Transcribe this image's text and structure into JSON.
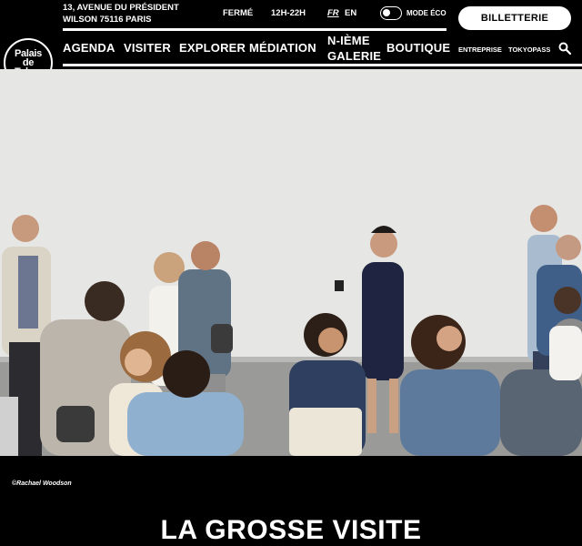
{
  "header": {
    "logo_text": "Palais\nde\nTokyo",
    "address": "13, AVENUE DU PRÉSIDENT\nWILSON 75116 PARIS",
    "status": "FERMÉ",
    "hours": "12H-22H",
    "lang_active": "FR",
    "lang_other": "EN",
    "eco_mode_label": "MODE ÉCO",
    "ticket_button": "BILLETTERIE"
  },
  "nav": {
    "items": [
      "AGENDA",
      "VISITER",
      "EXPLORER",
      "MÉDIATION",
      "N-IÈME\nGALERIE",
      "BOUTIQUE"
    ],
    "secondary": [
      "ENTREPRISE",
      "TOKYOPASS"
    ],
    "search_icon": "search-icon"
  },
  "hero": {
    "photo_credit": "©Rachael Woodson"
  },
  "main": {
    "title": "LA GROSSE VISITE"
  },
  "colors": {
    "background": "#000000",
    "foreground": "#ffffff",
    "wall": "#e6e6e4",
    "floor": "#9a9a98"
  }
}
